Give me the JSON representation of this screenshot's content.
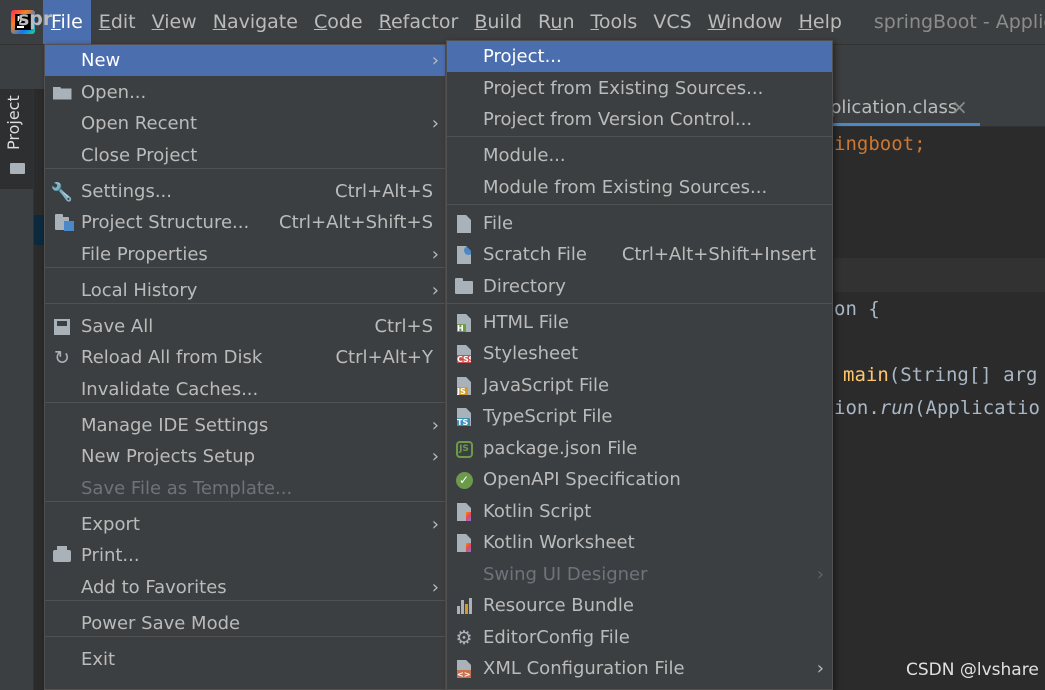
{
  "menubar": {
    "items": [
      {
        "label": "File",
        "mnemonic": "F",
        "rest": "ile",
        "active": true
      },
      {
        "label": "Edit",
        "mnemonic": "E",
        "rest": "dit"
      },
      {
        "label": "View",
        "mnemonic": "V",
        "rest": "iew"
      },
      {
        "label": "Navigate",
        "mnemonic": "N",
        "rest": "avigate"
      },
      {
        "label": "Code",
        "mnemonic": "C",
        "rest": "ode"
      },
      {
        "label": "Refactor",
        "mnemonic": "R",
        "rest": "efactor"
      },
      {
        "label": "Build",
        "mnemonic": "B",
        "rest": "uild"
      },
      {
        "label": "Run",
        "pre": "R",
        "mnemonic": "u",
        "rest": "n"
      },
      {
        "label": "Tools",
        "mnemonic": "T",
        "rest": "ools"
      },
      {
        "label": "VCS",
        "mnemonic": "",
        "rest": "VCS"
      },
      {
        "label": "Window",
        "mnemonic": "W",
        "rest": "indow"
      },
      {
        "label": "Help",
        "mnemonic": "H",
        "rest": "elp"
      }
    ],
    "window_title": "springBoot - Applica"
  },
  "background": {
    "project_crumb": "spr",
    "project_tab": "Project",
    "editor_tab": "plication.class",
    "editor_tab_close": "×",
    "code": {
      "line1_text": "ingboot",
      "line1_semicolon": ";",
      "line2": "on {",
      "line3_main": "main",
      "line3_rest": "(String[] arg",
      "line4_a": "ion.",
      "line4_run": "run",
      "line4_b": "(Applicatio"
    },
    "watermark": "CSDN @lvshare"
  },
  "file_menu": {
    "items": [
      {
        "label": "New",
        "icon": "",
        "submenu": true,
        "selected": true
      },
      {
        "label": "Open...",
        "icon": "folder-open-icon"
      },
      {
        "label": "Open Recent",
        "icon": "",
        "submenu": true
      },
      {
        "label": "Close Project",
        "icon": ""
      },
      {
        "label": "Settings...",
        "icon": "wrench-icon",
        "shortcut": "Ctrl+Alt+S"
      },
      {
        "label": "Project Structure...",
        "icon": "project-structure-icon",
        "shortcut": "Ctrl+Alt+Shift+S"
      },
      {
        "label": "File Properties",
        "icon": "",
        "submenu": true
      },
      {
        "label": "Local History",
        "icon": "",
        "submenu": true
      },
      {
        "label": "Save All",
        "icon": "save-icon",
        "shortcut": "Ctrl+S"
      },
      {
        "label": "Reload All from Disk",
        "icon": "reload-icon",
        "shortcut": "Ctrl+Alt+Y"
      },
      {
        "label": "Invalidate Caches...",
        "icon": ""
      },
      {
        "label": "Manage IDE Settings",
        "icon": "",
        "submenu": true
      },
      {
        "label": "New Projects Setup",
        "icon": "",
        "submenu": true
      },
      {
        "label": "Save File as Template...",
        "icon": "",
        "disabled": true
      },
      {
        "label": "Export",
        "icon": "",
        "submenu": true
      },
      {
        "label": "Print...",
        "icon": "printer-icon"
      },
      {
        "label": "Add to Favorites",
        "icon": "",
        "submenu": true
      },
      {
        "label": "Power Save Mode",
        "icon": ""
      },
      {
        "label": "Exit",
        "icon": ""
      }
    ],
    "submenu_arrow": "›"
  },
  "new_submenu": {
    "items": [
      {
        "label": "Project...",
        "selected": true
      },
      {
        "label": "Project from Existing Sources..."
      },
      {
        "label": "Project from Version Control..."
      },
      {
        "label": "Module..."
      },
      {
        "label": "Module from Existing Sources..."
      },
      {
        "label": "File",
        "icon": "file-icon"
      },
      {
        "label": "Scratch File",
        "icon": "scratch-file-icon",
        "shortcut": "Ctrl+Alt+Shift+Insert"
      },
      {
        "label": "Directory",
        "icon": "folder-icon"
      },
      {
        "label": "HTML File",
        "icon": "html-file-icon",
        "badge": "H"
      },
      {
        "label": "Stylesheet",
        "icon": "css-file-icon",
        "badge": "CSS"
      },
      {
        "label": "JavaScript File",
        "icon": "js-file-icon",
        "badge": "JS"
      },
      {
        "label": "TypeScript File",
        "icon": "ts-file-icon",
        "badge": "TS"
      },
      {
        "label": "package.json File",
        "icon": "nodejs-icon",
        "badge": "JS"
      },
      {
        "label": "OpenAPI Specification",
        "icon": "openapi-icon"
      },
      {
        "label": "Kotlin Script",
        "icon": "kotlin-icon"
      },
      {
        "label": "Kotlin Worksheet",
        "icon": "kotlin-icon"
      },
      {
        "label": "Swing UI Designer",
        "disabled": true,
        "submenu": true
      },
      {
        "label": "Resource Bundle",
        "icon": "resource-bundle-icon"
      },
      {
        "label": "EditorConfig File",
        "icon": "gear-icon"
      },
      {
        "label": "XML Configuration File",
        "icon": "xml-file-icon",
        "submenu": true
      }
    ]
  },
  "colors": {
    "menubar_bg": "#3c3f41",
    "selection": "#4b6eaf",
    "menu_text": "#bbbbbb",
    "disabled_text": "#6f737a",
    "editor_bg": "#2b2b2b"
  }
}
